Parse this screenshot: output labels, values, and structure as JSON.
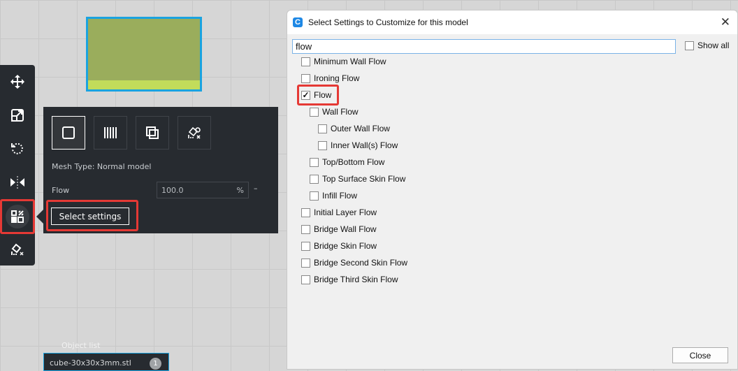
{
  "viewport": {
    "model_colors": {
      "side": "#9aad5c",
      "top": "#c2dc5a",
      "outline": "#1aa3e0"
    }
  },
  "toolbar": {
    "tools": [
      {
        "name": "move",
        "icon": "move-icon"
      },
      {
        "name": "scale",
        "icon": "scale-icon"
      },
      {
        "name": "rotate",
        "icon": "rotate-icon"
      },
      {
        "name": "mirror",
        "icon": "mirror-icon"
      },
      {
        "name": "per-model-settings",
        "icon": "per-model-settings-icon",
        "active": true
      },
      {
        "name": "support-blocker",
        "icon": "support-blocker-icon"
      }
    ]
  },
  "panel": {
    "mesh_type": "Mesh Type: Normal model",
    "flow_label": "Flow",
    "flow_value": "100.0",
    "flow_unit": "%",
    "reset": "–",
    "select_settings": "Select settings"
  },
  "object_list": {
    "label": "Object list",
    "file": "cube-30x30x3mm.stl",
    "count": "1"
  },
  "dialog": {
    "title": "Select Settings to Customize for this model",
    "search_value": "flow",
    "show_all": "Show all",
    "close": "Close",
    "items": [
      {
        "label": "Minimum Wall Flow",
        "level": 0,
        "checked": false
      },
      {
        "label": "Ironing Flow",
        "level": 0,
        "checked": false
      },
      {
        "label": "Flow",
        "level": 0,
        "checked": true
      },
      {
        "label": "Wall Flow",
        "level": 1,
        "checked": false
      },
      {
        "label": "Outer Wall Flow",
        "level": 2,
        "checked": false
      },
      {
        "label": "Inner Wall(s) Flow",
        "level": 2,
        "checked": false
      },
      {
        "label": "Top/Bottom Flow",
        "level": 1,
        "checked": false
      },
      {
        "label": "Top Surface Skin Flow",
        "level": 1,
        "checked": false
      },
      {
        "label": "Infill Flow",
        "level": 1,
        "checked": false
      },
      {
        "label": "Initial Layer Flow",
        "level": 0,
        "checked": false
      },
      {
        "label": "Bridge Wall Flow",
        "level": 0,
        "checked": false
      },
      {
        "label": "Bridge Skin Flow",
        "level": 0,
        "checked": false
      },
      {
        "label": "Bridge Second Skin Flow",
        "level": 0,
        "checked": false
      },
      {
        "label": "Bridge Third Skin Flow",
        "level": 0,
        "checked": false
      }
    ]
  },
  "highlight_color": "#e53935"
}
